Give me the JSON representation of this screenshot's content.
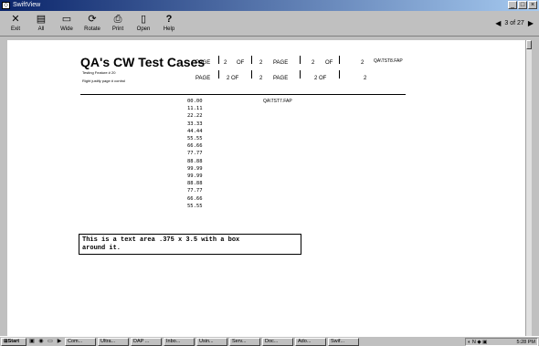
{
  "window": {
    "title": "SwiftView"
  },
  "toolbar": {
    "buttons": [
      {
        "label": "Exit",
        "icon": "close-icon"
      },
      {
        "label": "All",
        "icon": "all-pages-icon"
      },
      {
        "label": "Wide",
        "icon": "wide-icon"
      },
      {
        "label": "Rotate",
        "icon": "rotate-icon"
      },
      {
        "label": "Print",
        "icon": "print-icon"
      },
      {
        "label": "Open",
        "icon": "open-icon"
      },
      {
        "label": "Help",
        "icon": "help-icon"
      }
    ],
    "page_indicator": "3 of 27"
  },
  "document": {
    "title": "QA's CW Test Cases",
    "subtitle1": "Testing Feature # 20",
    "subtitle2": "Right justify page # control",
    "header_row1": [
      "PAGE",
      "2",
      "OF",
      "2",
      "PAGE",
      "2",
      "OF",
      "2"
    ],
    "header_row2": [
      "PAGE",
      "2 OF",
      "2",
      "PAGE",
      "2 OF",
      "2"
    ],
    "file_a": "QA\\TST8.FAP",
    "file_b": "QA\\TST7.FAP",
    "numbers": [
      "00.00",
      "11.11",
      "22.22",
      "33.33",
      "44.44",
      "55.55",
      "66.66",
      "77.77",
      "88.88",
      "99.99",
      "99.99",
      "88.88",
      "77.77",
      "66.66",
      "55.55"
    ],
    "textbox_line1": "This is a text area .375 x 3.5 with a box",
    "textbox_line2": "around it."
  },
  "taskbar": {
    "start": "Start",
    "tasks": [
      "Com...",
      "Ultra...",
      "DAP ...",
      "Inbo...",
      "Usin...",
      "Serv...",
      "Doc...",
      "Ado...",
      "Swif..."
    ],
    "clock": "5:28 PM"
  }
}
